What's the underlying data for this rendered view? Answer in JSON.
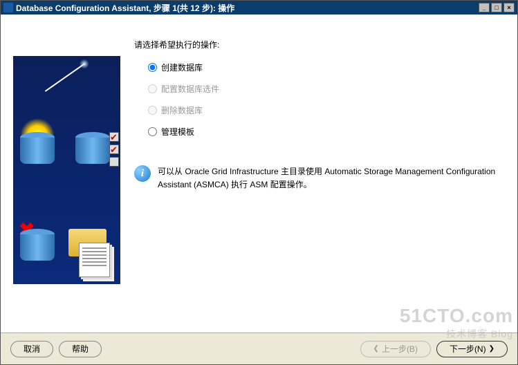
{
  "title": "Database Configuration Assistant, 步骤 1(共 12 步): 操作",
  "prompt": "请选择希望执行的操作:",
  "options": {
    "create": "创建数据库",
    "configure": "配置数据库选件",
    "delete": "删除数据库",
    "templates": "管理模板"
  },
  "infoIcon": "i",
  "infoText": "可以从 Oracle Grid Infrastructure 主目录使用 Automatic Storage Management Configuration Assistant (ASMCA) 执行 ASM 配置操作。",
  "buttons": {
    "cancel": "取消",
    "help": "帮助",
    "back": "上一步(B)",
    "next": "下一步(N)"
  },
  "watermark": {
    "main": "51CTO.com",
    "sub": "技术博客  Blog"
  },
  "winbtns": {
    "min": "_",
    "max": "□",
    "close": "×"
  }
}
